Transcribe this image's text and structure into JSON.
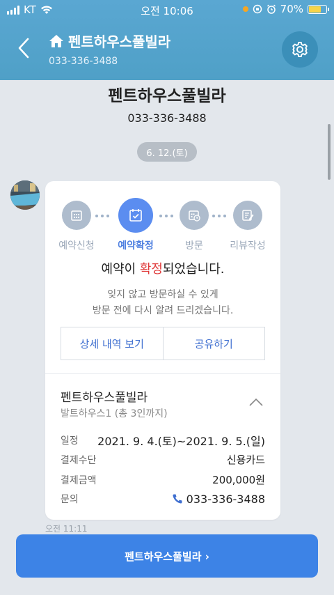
{
  "status_bar": {
    "carrier": "KT",
    "time": "오전 10:06",
    "battery": "70%",
    "battery_level": 0.7
  },
  "header": {
    "title": "펜트하우스풀빌라",
    "phone": "033-336-3488",
    "back_icon": "chevron-left-icon",
    "settings_icon": "gear-icon"
  },
  "chat": {
    "title": "펜트하우스풀빌라",
    "phone": "033-336-3488",
    "date_badge": "6. 12.(토)",
    "timestamp": "오전 11:11"
  },
  "card": {
    "steps": [
      {
        "label": "예약신청",
        "icon": "calendar-grid-icon",
        "active": false
      },
      {
        "label": "예약확정",
        "icon": "calendar-check-icon",
        "active": true
      },
      {
        "label": "방문",
        "icon": "calendar-clock-icon",
        "active": false
      },
      {
        "label": "리뷰작성",
        "icon": "edit-doc-icon",
        "active": false
      }
    ],
    "message_pre": "예약이 ",
    "message_highlight": "확정",
    "message_post": "되었습니다.",
    "sub_line1": "잊지 않고 방문하실 수 있게",
    "sub_line2": "방문 전에 다시 알려 드리겠습니다.",
    "detail_button": "상세 내역 보기",
    "share_button": "공유하기",
    "place_name": "펜트하우스풀빌라",
    "room_info": "발트하우스1 (총 3인까지)",
    "rows": [
      {
        "key": "일정",
        "value": "2021. 9. 4.(토)~2021. 9. 5.(일)"
      },
      {
        "key": "결제수단",
        "value": "신용카드"
      },
      {
        "key": "결제금액",
        "value": "200,000원"
      },
      {
        "key": "문의",
        "value": "033-336-3488"
      }
    ]
  },
  "cta": {
    "label": "펜트하우스풀빌라 ›"
  },
  "colors": {
    "header": "#55a4cf",
    "accent": "#4e7fe0",
    "step_inactive": "#aebccd",
    "highlight": "#e03b3b",
    "cta": "#3d83e6"
  }
}
